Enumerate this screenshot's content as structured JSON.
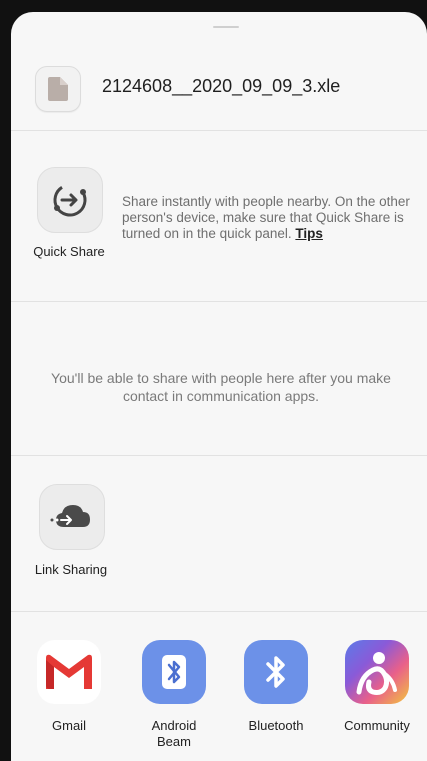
{
  "file": {
    "icon": "document-icon",
    "name": "2124608__2020_09_09_3.xle"
  },
  "quick_share": {
    "icon": "quick-share-icon",
    "label": "Quick Share",
    "description": "Share instantly with people nearby. On the other person's device, make sure that Quick Share is turned on in the quick panel.",
    "tips_label": "Tips"
  },
  "contacts_note": "You'll be able to share with people here after you make contact in communication apps.",
  "link_sharing": {
    "icon": "cloud-link-icon",
    "label": "Link Sharing"
  },
  "apps": [
    {
      "label": "Gmail",
      "icon": "gmail-icon"
    },
    {
      "label": "Android\nBeam",
      "icon": "android-beam-icon"
    },
    {
      "label": "Bluetooth",
      "icon": "bluetooth-icon"
    },
    {
      "label": "Community",
      "icon": "community-icon"
    }
  ],
  "colors": {
    "sheet_bg": "#f7f7f7",
    "bluetooth_blue": "#6c91e8",
    "gmail_red": "#e53935"
  }
}
